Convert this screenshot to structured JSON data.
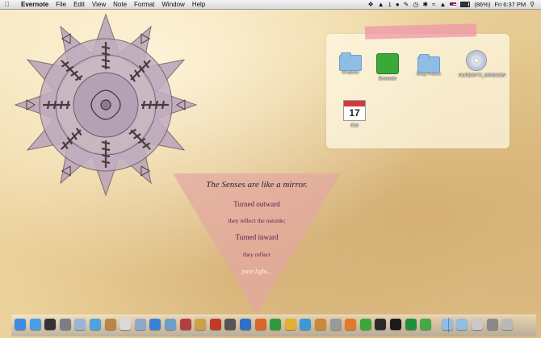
{
  "menubar": {
    "apple_icon": "apple-icon",
    "app_name": "Evernote",
    "menus": [
      "File",
      "Edit",
      "View",
      "Note",
      "Format",
      "Window",
      "Help"
    ],
    "status": {
      "battery_percent": "(86%)",
      "clock": "Fri 6:37 PM",
      "adobe_count": "1"
    }
  },
  "desktop": {
    "icons": [
      {
        "label": "Dropbox",
        "kind": "folder-icon"
      },
      {
        "label": "Evernote",
        "kind": "evernote-icon"
      },
      {
        "label": "Blog Photos",
        "kind": "folder-icon"
      },
      {
        "label": "HURDAYTJ_MOSCOW",
        "kind": "disc-icon"
      },
      {
        "label": "iCal",
        "kind": "calendar-icon",
        "date": "17"
      }
    ]
  },
  "poem": {
    "title": "The Senses are like a mirror.",
    "line1": "Turned outward",
    "line2": "they reflect the outside;",
    "line3": "Turned inward",
    "line4": "they reflect",
    "line5": "pure light..."
  },
  "colors": {
    "tape": "#f096aa",
    "triangle": "#e3a8a0",
    "poem_text": "#5a1a4a"
  },
  "dock": {
    "icons": [
      {
        "name": "finder-icon",
        "color": "#3d8de0"
      },
      {
        "name": "safari-icon",
        "color": "#4aa0e8"
      },
      {
        "name": "dashboard-icon",
        "color": "#333333"
      },
      {
        "name": "system-preferences-icon",
        "color": "#7d7d86"
      },
      {
        "name": "mail-icon",
        "color": "#9bb4d6"
      },
      {
        "name": "ichat-icon",
        "color": "#4da3e0"
      },
      {
        "name": "address-book-icon",
        "color": "#b8864a"
      },
      {
        "name": "ical-icon",
        "color": "#d9d9d9"
      },
      {
        "name": "preview-icon",
        "color": "#8da9c8"
      },
      {
        "name": "itunes-icon",
        "color": "#3a7fd5"
      },
      {
        "name": "iphoto-icon",
        "color": "#6aa0c8"
      },
      {
        "name": "photo-booth-icon",
        "color": "#b04040"
      },
      {
        "name": "star-icon",
        "color": "#c9a24a"
      },
      {
        "name": "book-icon",
        "color": "#c0392b"
      },
      {
        "name": "apps-icon",
        "color": "#555555"
      },
      {
        "name": "word-icon",
        "color": "#2f6fc8"
      },
      {
        "name": "powerpoint-icon",
        "color": "#d9662b"
      },
      {
        "name": "excel-icon",
        "color": "#2e9a3e"
      },
      {
        "name": "lamp-icon",
        "color": "#e0b030"
      },
      {
        "name": "messenger-icon",
        "color": "#3a9ad9"
      },
      {
        "name": "pitcher-icon",
        "color": "#c98a3a"
      },
      {
        "name": "mouse-icon",
        "color": "#9a9a9a"
      },
      {
        "name": "firefox-icon",
        "color": "#e27a2a"
      },
      {
        "name": "evernote-icon",
        "color": "#3aa93a"
      },
      {
        "name": "camera-icon",
        "color": "#2a2a2a"
      },
      {
        "name": "batman-icon",
        "color": "#1a1a1a"
      },
      {
        "name": "spotify-icon",
        "color": "#1e8f3a"
      },
      {
        "name": "evernote-2-icon",
        "color": "#46a846"
      },
      {
        "name": "downloads-folder-icon",
        "color": "#8fbde6"
      },
      {
        "name": "documents-folder-icon",
        "color": "#8fbde6"
      },
      {
        "name": "stack-icon",
        "color": "#c9c9c9"
      },
      {
        "name": "dock-folder-icon",
        "color": "#8a8a8a"
      },
      {
        "name": "trash-icon",
        "color": "#b9b9b9"
      }
    ]
  }
}
